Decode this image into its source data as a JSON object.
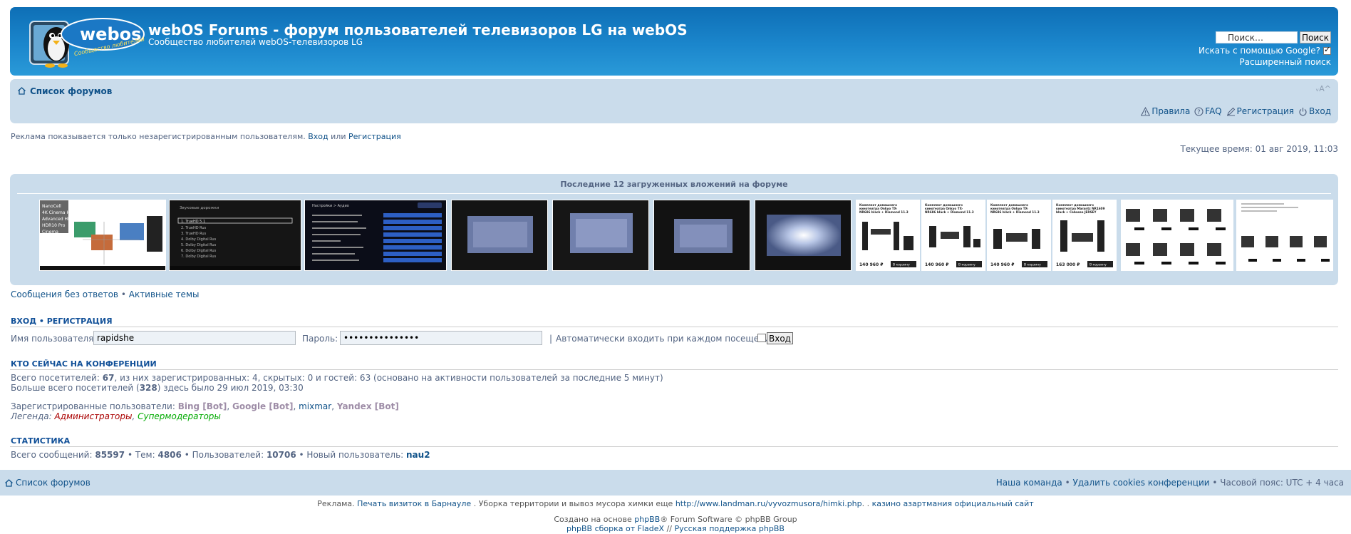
{
  "header": {
    "logo_text": "webos",
    "logo_sub": "Сообщество любителей",
    "title": "webOS Forums - форум пользователей телевизоров LG на webOS",
    "description": "Сообщество любителей webOS-телевизоров LG",
    "search": {
      "placeholder": "Поиск…",
      "value": "Поиск…",
      "button": "Поиск",
      "google_label": "Искать с помощью Google?",
      "google_checked": true,
      "advanced": "Расширенный поиск"
    }
  },
  "navbar": {
    "forums_link": "Список форумов",
    "font_resize": "ᵥA^",
    "links": [
      {
        "label": "Правила",
        "icon": "warning-icon"
      },
      {
        "label": "FAQ",
        "icon": "question-icon"
      },
      {
        "label": "Регистрация",
        "icon": "register-icon"
      },
      {
        "label": "Вход",
        "icon": "power-icon"
      }
    ]
  },
  "notices": {
    "ad_text": "Реклама показывается только незарегистрированным пользователям.",
    "login_link": "Вход",
    "or": "или",
    "register_link": "Регистрация",
    "current_time": "Текущее время: 01 авг 2019, 11:03"
  },
  "attachments": {
    "title": "Последние 12 загруженных вложений на форуме",
    "thumbs": [
      {
        "kind": "hdr-diagram",
        "labels": [
          "NanoCell",
          "4K Cinema HDR",
          "Advanced HDR",
          "HDR10 Pro",
          "Cinema"
        ]
      },
      {
        "kind": "menu-dark",
        "labels": [
          "Звуковые дорожки",
          "1. TrueHD 5.1",
          "2. TrueHD Rus",
          "3. TrueHD Rus",
          "4. Dolby Digital Rus",
          "5. Dolby Digital Rus",
          "6. Dolby Digital Rus",
          "7. Dolby Digital Rus"
        ]
      },
      {
        "kind": "settings-menu",
        "labels": [
          "Настройки > Аудио"
        ]
      },
      {
        "kind": "dark-screen"
      },
      {
        "kind": "dark-screen"
      },
      {
        "kind": "dark-screen"
      },
      {
        "kind": "bright-screen"
      },
      {
        "kind": "product",
        "title": "Комплект домашнего кинотеатра Onkyo TX-NR686 black + Diamond 11.3",
        "price": "140 960 ₽",
        "btn": "В корзину"
      },
      {
        "kind": "product",
        "title": "Комплект домашнего кинотеатра Onkyo TX-NR686 black + Diamond 11.3",
        "price": "140 960 ₽",
        "btn": "В корзину"
      },
      {
        "kind": "product",
        "title": "Комплект домашнего кинотеатра Onkyo TX-NR686 black + Diamond 11.3",
        "price": "140 960 ₽",
        "btn": "В корзину"
      },
      {
        "kind": "product",
        "title": "Комплект домашнего кинотеатра Marantz NR1609 black + Cabasse JERSEY",
        "price": "163 000 ₽",
        "btn": "В корзину"
      },
      {
        "kind": "product-grid"
      },
      {
        "kind": "product-grid"
      }
    ]
  },
  "search_links": {
    "unanswered": "Сообщения без ответов",
    "sep": "•",
    "active": "Активные темы"
  },
  "login": {
    "title_login": "ВХОД",
    "sep": "•",
    "title_register": "РЕГИСТРАЦИЯ",
    "username_label": "Имя пользователя:",
    "username_value": "rapidshe",
    "password_label": "Пароль:",
    "password_value": "•••••••••••••••",
    "pipe": "|",
    "auto_label": "Автоматически входить при каждом посещении",
    "button": "Вход"
  },
  "online": {
    "title": "КТО СЕЙЧАС НА КОНФЕРЕНЦИИ",
    "line1_pre": "Всего посетителей:",
    "total": "67",
    "line1_post": ", из них зарегистрированных: 4, скрытых: 0 и гостей: 63 (основано на активности пользователей за последние 5 минут)",
    "line2_pre": "Больше всего посетителей (",
    "record": "328",
    "line2_post": ") здесь было 29 июл 2019, 03:30",
    "registered_label": "Зарегистрированные пользователи:",
    "users": [
      {
        "name": "Bing [Bot]",
        "type": "bot"
      },
      {
        "name": "Google [Bot]",
        "type": "bot"
      },
      {
        "name": "mixmar",
        "type": "user"
      },
      {
        "name": "Yandex [Bot]",
        "type": "bot"
      }
    ],
    "legend_label": "Легенда:",
    "legend_admin": "Администраторы",
    "legend_mod": "Супермодераторы"
  },
  "stats": {
    "title": "СТАТИСТИКА",
    "posts_label": "Всего сообщений:",
    "posts": "85597",
    "topics_label": "• Тем:",
    "topics": "4806",
    "users_label": "• Пользователей:",
    "users": "10706",
    "newest_label": "• Новый пользователь:",
    "newest": "nau2"
  },
  "footer": {
    "forums_link": "Список форумов",
    "team": "Наша команда",
    "sep": "•",
    "delete_cookies": "Удалить cookies конференции",
    "timezone": "• Часовой пояс: UTC + 4 часа",
    "ads_pre": "Реклама.",
    "ad1": "Печать визиток в Барнауле",
    "ads_mid": ". Уборка территории и вывоз мусора химки еще",
    "ad2": "http://www.landman.ru/vyvozmusora/himki.php",
    "ads_mid2": ". .",
    "ad3": "казино азартмания официальный сайт",
    "created_pre": "Создано на основе",
    "phpbb": "phpBB",
    "created_post": "® Forum Software © phpBB Group",
    "build_pre": "phpBB сборка от",
    "fladex": "FladeX",
    "build_mid": "//",
    "ru_support": "Русская поддержка phpBB"
  }
}
